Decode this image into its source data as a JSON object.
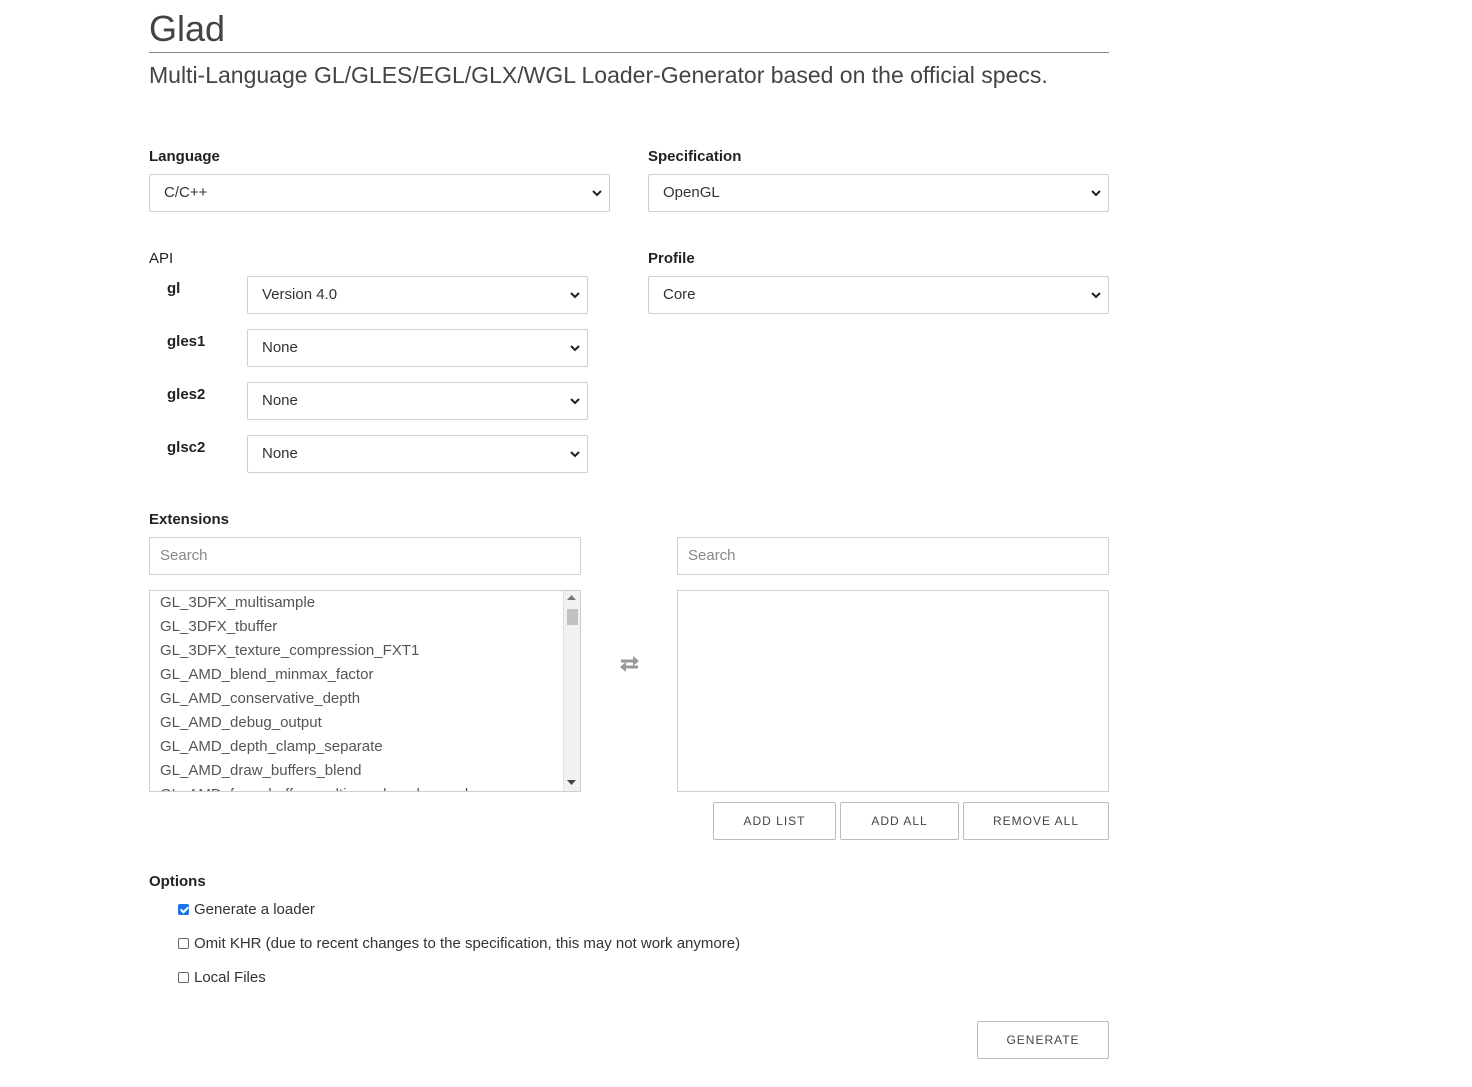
{
  "header": {
    "title": "Glad",
    "subtitle": "Multi-Language GL/GLES/EGL/GLX/WGL Loader-Generator based on the official specs."
  },
  "language": {
    "label": "Language",
    "value": "C/C++"
  },
  "specification": {
    "label": "Specification",
    "value": "OpenGL"
  },
  "api": {
    "label": "API",
    "rows": [
      {
        "name": "gl",
        "value": "Version 4.0"
      },
      {
        "name": "gles1",
        "value": "None"
      },
      {
        "name": "gles2",
        "value": "None"
      },
      {
        "name": "glsc2",
        "value": "None"
      }
    ]
  },
  "profile": {
    "label": "Profile",
    "value": "Core"
  },
  "extensions": {
    "label": "Extensions",
    "left_search_placeholder": "Search",
    "right_search_placeholder": "Search",
    "available": [
      "GL_3DFX_multisample",
      "GL_3DFX_tbuffer",
      "GL_3DFX_texture_compression_FXT1",
      "GL_AMD_blend_minmax_factor",
      "GL_AMD_conservative_depth",
      "GL_AMD_debug_output",
      "GL_AMD_depth_clamp_separate",
      "GL_AMD_draw_buffers_blend",
      "GL_AMD_framebuffer_multisample_advanced"
    ],
    "swap_icon": "swap-arrows-icon",
    "buttons": {
      "add_list": "ADD LIST",
      "add_all": "ADD ALL",
      "remove_all": "REMOVE ALL"
    }
  },
  "options": {
    "label": "Options",
    "items": [
      {
        "label": "Generate a loader",
        "checked": true
      },
      {
        "label": "Omit KHR (due to recent changes to the specification, this may not work anymore)",
        "checked": false
      },
      {
        "label": "Local Files",
        "checked": false
      }
    ]
  },
  "generate_button": "GENERATE",
  "colors": {
    "checkbox_checked": "#1a73e8",
    "border": "#cfcfcf"
  }
}
